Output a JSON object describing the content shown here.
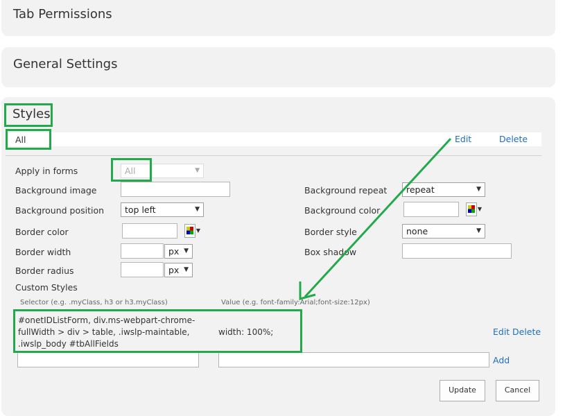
{
  "panels": {
    "tab_permissions": "Tab Permissions",
    "general_settings": "General Settings",
    "styles": "Styles"
  },
  "styles": {
    "style_name": "All",
    "edit_label": "Edit",
    "delete_label": "Delete",
    "apply_in_forms_label": "Apply in forms",
    "apply_in_forms_value": "All",
    "background_image_label": "Background image",
    "background_repeat_label": "Background repeat",
    "background_repeat_value": "repeat",
    "background_position_label": "Background position",
    "background_position_value": "top left",
    "background_color_label": "Background color",
    "border_color_label": "Border color",
    "border_style_label": "Border style",
    "border_style_value": "none",
    "border_width_label": "Border width",
    "border_width_unit": "px",
    "box_shadow_label": "Box shadow",
    "border_radius_label": "Border radius",
    "border_radius_unit": "px",
    "custom_styles_label": "Custom Styles",
    "selector_hint": "Selector (e.g. .myClass, h3 or h3.myClass)",
    "value_hint": "Value (e.g. font-family:Arial;font-size:12px)",
    "custom_rule": {
      "selector": "#onetIDListForm, div.ms-webpart-chrome-fullWidth > div > table, .iwslp-maintable, .iwslp_body #tbAllFields",
      "value": "width: 100%;",
      "edit_label": "Edit",
      "delete_label": "Delete"
    },
    "add_label": "Add",
    "update_label": "Update",
    "cancel_label": "Cancel"
  },
  "colors": {
    "highlight": "#22a94b",
    "link": "#1f6fb8",
    "panel_bg": "#f2f2f2"
  }
}
